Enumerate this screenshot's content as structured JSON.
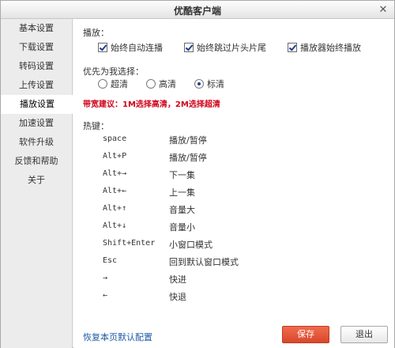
{
  "window": {
    "title": "优酷客户端",
    "close_glyph": "✕"
  },
  "sidebar": {
    "items": [
      {
        "label": "基本设置"
      },
      {
        "label": "下载设置"
      },
      {
        "label": "转码设置"
      },
      {
        "label": "上传设置"
      },
      {
        "label": "播放设置",
        "active": true
      },
      {
        "label": "加速设置"
      },
      {
        "label": "软件升级"
      },
      {
        "label": "反馈和帮助"
      },
      {
        "label": "关于"
      }
    ]
  },
  "playback": {
    "section_label": "播放：",
    "options": [
      {
        "label": "始终自动连播",
        "checked": true
      },
      {
        "label": "始终跳过片头片尾",
        "checked": true
      },
      {
        "label": "播放器始终播放",
        "checked": true
      }
    ]
  },
  "quality": {
    "section_label": "优先为我选择：",
    "options": [
      {
        "label": "超清",
        "selected": false
      },
      {
        "label": "高清",
        "selected": false
      },
      {
        "label": "标清",
        "selected": true
      }
    ],
    "advice": "带宽建议：1M选择高清，2M选择超清"
  },
  "hotkeys": {
    "section_label": "热键：",
    "rows": [
      {
        "key": "space",
        "action": "播放/暂停"
      },
      {
        "key": "Alt+P",
        "action": "播放/暂停"
      },
      {
        "key": "Alt+→",
        "action": "下一集"
      },
      {
        "key": "Alt+←",
        "action": "上一集"
      },
      {
        "key": "Alt+↑",
        "action": "音量大"
      },
      {
        "key": "Alt+↓",
        "action": "音量小"
      },
      {
        "key": "Shift+Enter",
        "action": "小窗口模式"
      },
      {
        "key": "Esc",
        "action": "回到默认窗口模式"
      },
      {
        "key": "→",
        "action": "快进"
      },
      {
        "key": "←",
        "action": "快退"
      }
    ]
  },
  "footer": {
    "restore_link": "恢复本页默认配置",
    "save_label": "保存",
    "exit_label": "退出"
  },
  "colors": {
    "accent_red": "#d0021b",
    "save_button": "#e5573a",
    "link_blue": "#1e5aa8"
  }
}
